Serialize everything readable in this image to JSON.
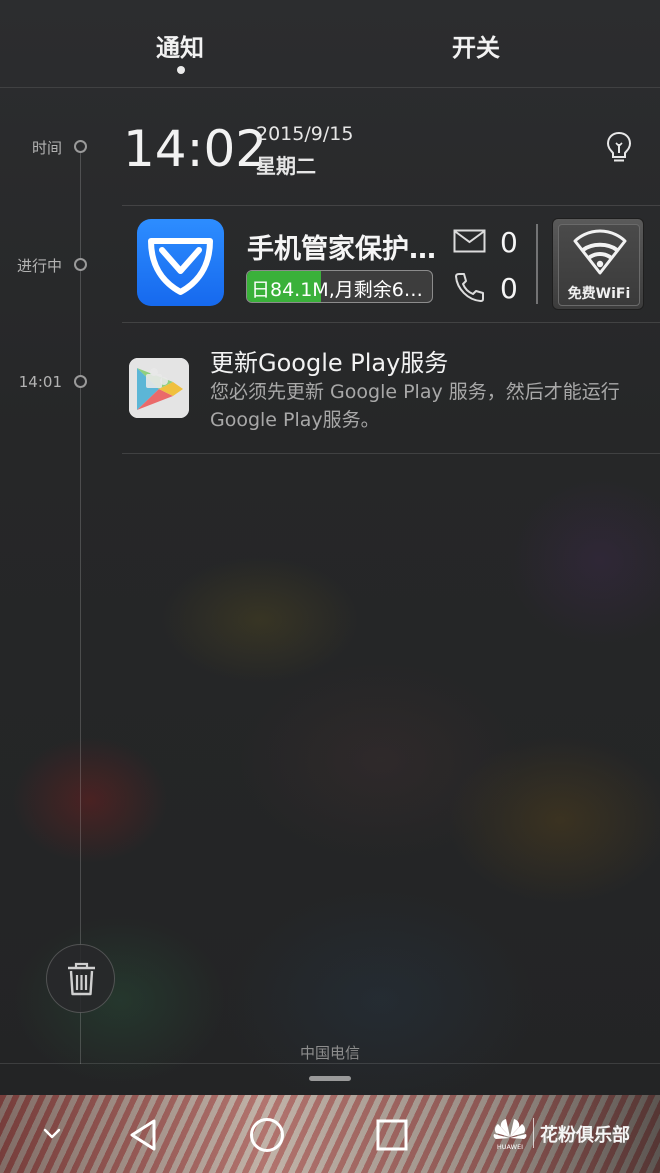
{
  "tabs": {
    "notifications": "通知",
    "switches": "开关"
  },
  "timeline": {
    "time_label": "时间",
    "ongoing_label": "进行中",
    "item_time": "14:01"
  },
  "clock": {
    "time": "14:02",
    "date": "2015/9/15",
    "weekday": "星期二"
  },
  "tencent_card": {
    "title": "手机管家保护…",
    "traffic_text": "日84.1M,月剩余6…",
    "traffic_fill_fraction": 0.4,
    "mail_count": "0",
    "call_count": "0",
    "wifi_button_label": "免费WiFi"
  },
  "google_play_card": {
    "title": "更新Google Play服务",
    "body": "您必须先更新 Google Play 服务，然后才能运行Google Play服务。"
  },
  "carrier": "中国电信",
  "watermark": {
    "brand": "HUAWEI",
    "text": "花粉俱乐部"
  },
  "colors": {
    "accent_blue": "#1f7cf5",
    "traffic_green": "#3ab13a"
  }
}
